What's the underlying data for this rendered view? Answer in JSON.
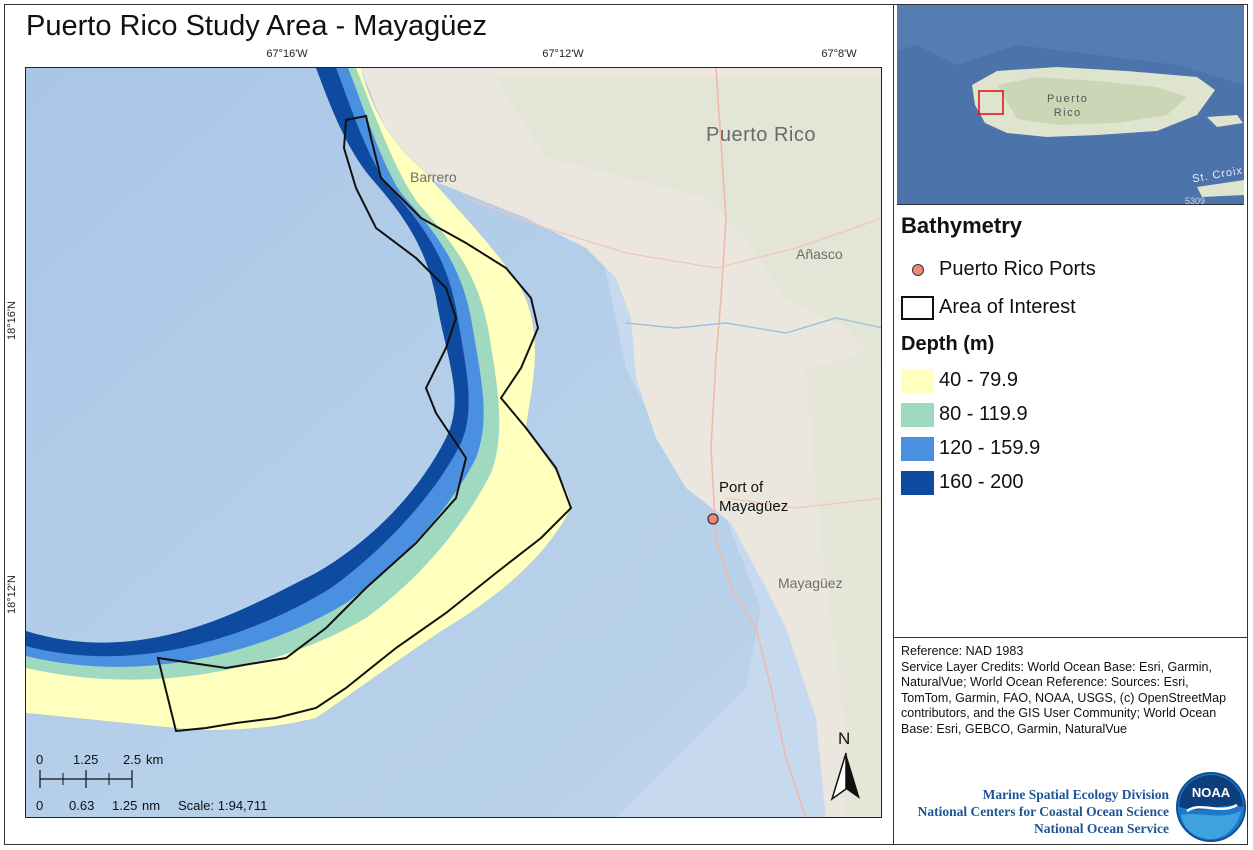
{
  "title": "Puerto Rico Study Area - Mayagüez",
  "coords": {
    "top": [
      "67°16'W",
      "67°12'W",
      "67°8'W"
    ],
    "left": [
      "18°16'N",
      "18°12'N"
    ]
  },
  "places": {
    "region": "Puerto Rico",
    "barrero": "Barrero",
    "anasco": "Añasco",
    "mayaguez": "Mayagüez",
    "port_line1": "Port of",
    "port_line2": "Mayagüez"
  },
  "inset": {
    "island_line1": "Puerto",
    "island_line2": "Rico",
    "st_croix": "St. Croix",
    "number": "5309"
  },
  "legend": {
    "title": "Bathymetry",
    "ports": "Puerto Rico Ports",
    "aoi": "Area of Interest",
    "depth_title": "Depth (m)",
    "classes": [
      {
        "label": "40 - 79.9",
        "color": "#ffffbe"
      },
      {
        "label": "80 - 119.9",
        "color": "#9fd9bf"
      },
      {
        "label": "120 - 159.9",
        "color": "#4a8fe0"
      },
      {
        "label": "160 - 200",
        "color": "#0e4aa0"
      }
    ],
    "port_color": "#f08878"
  },
  "scalebar": {
    "km_labels": [
      "0",
      "1.25",
      "2.5",
      "km"
    ],
    "nm_labels": [
      "0",
      "0.63",
      "1.25",
      "nm"
    ],
    "scale": "Scale: 1:94,711"
  },
  "north_label": "N",
  "reference": {
    "line1": "Reference: NAD 1983",
    "line2": "Service Layer Credits: World Ocean Base: Esri, Garmin, NaturalVue; World Ocean Reference: Sources:  Esri, TomTom, Garmin, FAO, NOAA, USGS, (c) OpenStreetMap contributors, and the GIS User Community; World Ocean Base: Esri, GEBCO, Garmin, NaturalVue"
  },
  "credits": {
    "line1": "Marine Spatial Ecology Division",
    "line2": "National Centers for Coastal Ocean Science",
    "line3": "National Ocean Service"
  },
  "logo_text": "NOAA"
}
